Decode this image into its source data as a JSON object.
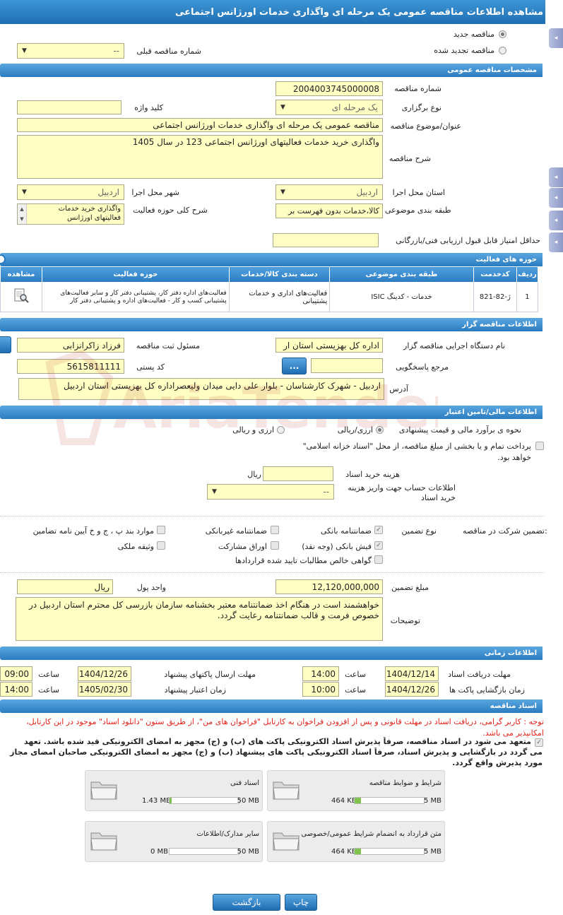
{
  "title": "مشاهده اطلاعات مناقصه عمومی یک مرحله ای واگذاری خدمات اورژانس اجتماعی",
  "top": {
    "radio_new": "مناقصه جدید",
    "radio_renewed": "مناقصه تجدید شده",
    "prev_number_label": "شماره مناقصه قبلی",
    "prev_number_value": "--"
  },
  "general": {
    "section_title": "مشخصات مناقصه عمومی",
    "number_label": "شماره مناقصه",
    "number_value": "2004003745000008",
    "holding_type_label": "نوع برگزاری",
    "holding_type_value": "یک مرحله ای",
    "keyword_label": "کلید واژه",
    "keyword_value": "",
    "subject_label": "عنوان/موضوع مناقصه",
    "subject_value": "مناقصه عمومی یک مرحله ای واگذاری خدمات اورژانس اجتماعی",
    "desc_label": "شرح مناقصه",
    "desc_value": "واگذاری خرید خدمات فعالیتهای اورژانس اجتماعی 123 در سال 1405",
    "province_label": "استان محل اجرا",
    "province_value": "اردبیل",
    "city_label": "شهر محل اجرا",
    "city_value": "اردبیل",
    "category_label": "طبقه بندی موضوعی",
    "category_value": "کالا،خدمات بدون فهرست بر",
    "activity_desc_label": "شرح کلی حوزه فعالیت",
    "activity_desc_value": "واگذاری خرید خدمات فعالیتهای اورژانس",
    "min_score_label": "حداقل امتیاز قابل قبول ارزیابی فنی/بازرگانی",
    "min_score_value": ""
  },
  "activity": {
    "section_title": "حوزه های فعالیت",
    "headers": [
      "ردیف",
      "کدخدمت",
      "طبقه بندی موضوعی",
      "دسته بندی کالا/خدمات",
      "حوزه فعالیت",
      "مشاهده"
    ],
    "rows": [
      {
        "index": "1",
        "code": "ژ-82-821",
        "category": "خدمات - کدینگ ISIC",
        "group": "فعالیت‌های اداری و خدمات پشتیبانی",
        "field": "فعالیت‌های اداره دفتر کار، پشتیبانی دفتر کار و سایر فعالیت‌های پشتیبانی کسب و کار - فعالیت‌های اداره و پشتیبانی دفتر کار"
      }
    ]
  },
  "organizer": {
    "section_title": "اطلاعات مناقصه گزار",
    "agency_label": "نام دستگاه اجرایی مناقصه گزار",
    "agency_value": "اداره کل بهزیستی استان ار",
    "responsible_label": "مسئول ثبت مناقصه",
    "responsible_value": "فرزاد زاکرانزابی",
    "ref_label": "مرجع پاسخگویی",
    "ref_value": "",
    "ref_button": "...",
    "postal_label": "کد پستی",
    "postal_value": "5615811111",
    "address_label": "آدرس",
    "address_value": "اردبیل - شهرک کارشناسان - بلوار علی دایی میدان ولیعصراداره کل بهزیستی استان اردبیل"
  },
  "finance": {
    "section_title": "اطلاعات مالی/تامین اعتبار",
    "estimate_label": "نحوه ی برآورد مالی و قیمت پیشنهادی",
    "opt_currency": "ارزی/ریالی",
    "opt_currency_rial": "ارزی و ریالی",
    "treasury_text": "پرداخت تمام و یا بخشی از مبلغ مناقصه، از محل \"اسناد خزانه اسلامی\" خواهد بود.",
    "doc_cost_label": "هزینه خرید اسناد",
    "doc_cost_unit": "ریال",
    "account_label": "اطلاعات حساب جهت واریز هزینه خرید اسناد",
    "account_value": "--"
  },
  "guarantee": {
    "participation_label": "تضمین شرکت در مناقصه:",
    "type_label": "نوع تضمین",
    "opt_bank": "ضمانتنامه بانکی",
    "opt_nonbank": "ضمانتنامه غیربانکی",
    "opt_items": "موارد بند پ ، ج و خ آیین نامه تضامین",
    "opt_cash": "فیش بانکی (وجه نقد)",
    "opt_bonds": "اوراق مشارکت",
    "opt_property": "وثیقه ملکی",
    "opt_claims": "گواهی خالص مطالبات تایید شده قراردادها",
    "amount_label": "مبلغ تضمین",
    "amount_value": "12,120,000,000",
    "currency_label": "واحد پول",
    "currency_value": "ریال",
    "notes_label": "توضیحات",
    "notes_value": "خواهشمند است در هنگام اخذ ضمانتنامه معتبر بخشنامه سازمان بازرسی کل محترم استان اردبیل در خصوص فرمت و قالب ضمانتنامه رعایت گردد."
  },
  "timing": {
    "section_title": "اطلاعات زمانی",
    "doc_receive_label": "مهلت دریافت اسناد",
    "doc_receive_date": "1404/12/14",
    "doc_receive_time": "14:00",
    "send_deadline_label": "مهلت ارسال پاکتهای پیشنهاد",
    "send_deadline_date": "1404/12/26",
    "send_deadline_time": "09:00",
    "open_label": "زمان بازگشایی پاکت ها",
    "open_date": "1404/12/26",
    "open_time": "10:00",
    "validity_label": "زمان اعتبار پیشنهاد",
    "validity_date": "1405/02/30",
    "validity_time": "14:00",
    "time_label": "ساعت"
  },
  "docs": {
    "section_title": "اسناد مناقصه",
    "notice": "توجه : کاربر گرامی، دریافت اسناد در مهلت قانونی و پس از افزودن فراخوان به کارتابل \"فراخوان های من\"، از طریق ستون \"دانلود اسناد\" موجود در این کارتابل، امکانپذیر می باشد.",
    "commit_line1": "متعهد می شود در اسناد مناقصه، صرفاً پذیرش اسناد الکترونیکی پاکت های (ب) و (ج) مجهز به امضای الکترونیکی قید شده باشد. تعهد",
    "commit_line2": "می گردد در بازگشایی و پذیرش اسناد، صرفاً اسناد الکترونیکی پاکت های پیشنهاد (ب) و (ج) مجهز به امضای الکترونیکی صاحبان امضای مجاز",
    "commit_line3": "مورد پذیرش واقع گردد.",
    "files": [
      {
        "name": "شرایط و ضوابط مناقصه",
        "size": "464 KB",
        "max": "5 MB",
        "fill": 0.09
      },
      {
        "name": "اسناد فنی",
        "size": "1.43 MB",
        "max": "50 MB",
        "fill": 0.03
      },
      {
        "name": "متن قرارداد به انضمام شرایط عمومی/خصوصی",
        "size": "464 KB",
        "max": "5 MB",
        "fill": 0.09
      },
      {
        "name": "سایر مدارک/اطلاعات",
        "size": "0 MB",
        "max": "50 MB",
        "fill": 0.0
      }
    ]
  },
  "buttons": {
    "print": "چاپ",
    "back": "بازگشت"
  },
  "watermark": "AriaTender.neT",
  "colors": {
    "header_blue": "#2a7cc0",
    "field_yellow": "#ffffc4",
    "notice_red": "#e0221a"
  }
}
